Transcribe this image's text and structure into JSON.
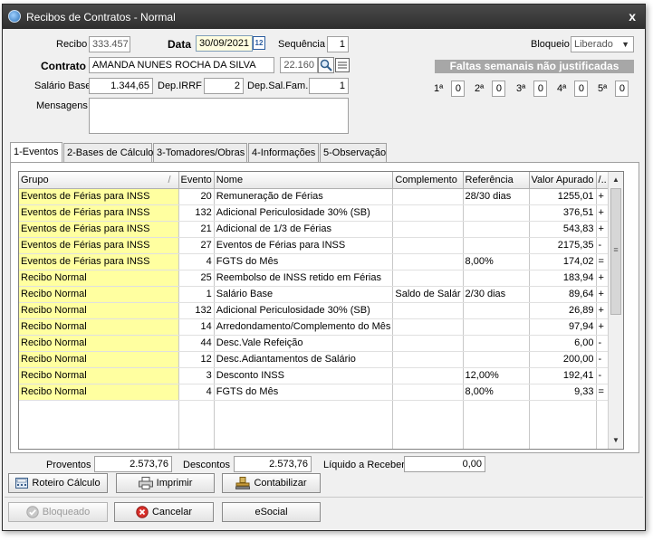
{
  "window": {
    "title": "Recibos de Contratos - Normal",
    "close": "x"
  },
  "form": {
    "recibo_label": "Recibo",
    "recibo_value": "333.457",
    "data_label": "Data",
    "data_value": "30/09/2021",
    "calendar_day": "12",
    "sequencia_label": "Sequência",
    "sequencia_value": "1",
    "bloqueio_label": "Bloqueio",
    "bloqueio_value": "Liberado",
    "contrato_label": "Contrato",
    "contrato_nome": "AMANDA NUNES ROCHA DA SILVA",
    "contrato_num": "22.160",
    "salario_label": "Salário Base",
    "salario_value": "1.344,65",
    "dep_irrf_label": "Dep.IRRF",
    "dep_irrf_value": "2",
    "dep_salfam_label": "Dep.Sal.Fam.",
    "dep_salfam_value": "1",
    "mensagens_label": "Mensagens",
    "mensagens_value": ""
  },
  "faltas": {
    "title": "Faltas semanais não justificadas",
    "weeks": [
      {
        "label": "1ª",
        "value": "0"
      },
      {
        "label": "2ª",
        "value": "0"
      },
      {
        "label": "3ª",
        "value": "0"
      },
      {
        "label": "4ª",
        "value": "0"
      },
      {
        "label": "5ª",
        "value": "0"
      }
    ]
  },
  "tabs": [
    {
      "label": "1-Eventos",
      "active": true
    },
    {
      "label": "2-Bases de Cálculo",
      "active": false
    },
    {
      "label": "3-Tomadores/Obras",
      "active": false
    },
    {
      "label": "4-Informações",
      "active": false
    },
    {
      "label": "5-Observação",
      "active": false
    }
  ],
  "grid": {
    "columns": [
      "Grupo",
      "Evento",
      "Nome",
      "Complemento",
      "Referência",
      "Valor Apurado",
      "/.."
    ],
    "sort_indicator": "/",
    "rows": [
      {
        "grupo": "Eventos de Férias para INSS",
        "evento": "20",
        "nome": "Remuneração de Férias",
        "complemento": "",
        "referencia": "28/30 dias",
        "valor": "1255,01",
        "sinal": "+"
      },
      {
        "grupo": "Eventos de Férias para INSS",
        "evento": "132",
        "nome": "Adicional Periculosidade 30% (SB)",
        "complemento": "",
        "referencia": "",
        "valor": "376,51",
        "sinal": "+"
      },
      {
        "grupo": "Eventos de Férias para INSS",
        "evento": "21",
        "nome": "Adicional de 1/3 de Férias",
        "complemento": "",
        "referencia": "",
        "valor": "543,83",
        "sinal": "+"
      },
      {
        "grupo": "Eventos de Férias para INSS",
        "evento": "27",
        "nome": "Eventos de Férias para INSS",
        "complemento": "",
        "referencia": "",
        "valor": "2175,35",
        "sinal": "-"
      },
      {
        "grupo": "Eventos de Férias para INSS",
        "evento": "4",
        "nome": "FGTS do Mês",
        "complemento": "",
        "referencia": "8,00%",
        "valor": "174,02",
        "sinal": "="
      },
      {
        "grupo": "Recibo Normal",
        "evento": "25",
        "nome": "Reembolso de INSS retido em Férias",
        "complemento": "",
        "referencia": "",
        "valor": "183,94",
        "sinal": "+"
      },
      {
        "grupo": "Recibo Normal",
        "evento": "1",
        "nome": "Salário Base",
        "complemento": "Saldo de Salár",
        "referencia": "2/30 dias",
        "valor": "89,64",
        "sinal": "+"
      },
      {
        "grupo": "Recibo Normal",
        "evento": "132",
        "nome": "Adicional Periculosidade 30% (SB)",
        "complemento": "",
        "referencia": "",
        "valor": "26,89",
        "sinal": "+"
      },
      {
        "grupo": "Recibo Normal",
        "evento": "14",
        "nome": "Arredondamento/Complemento do Mês",
        "complemento": "",
        "referencia": "",
        "valor": "97,94",
        "sinal": "+"
      },
      {
        "grupo": "Recibo Normal",
        "evento": "44",
        "nome": "Desc.Vale Refeição",
        "complemento": "",
        "referencia": "",
        "valor": "6,00",
        "sinal": "-"
      },
      {
        "grupo": "Recibo Normal",
        "evento": "12",
        "nome": "Desc.Adiantamentos de Salário",
        "complemento": "",
        "referencia": "",
        "valor": "200,00",
        "sinal": "-"
      },
      {
        "grupo": "Recibo Normal",
        "evento": "3",
        "nome": "Desconto INSS",
        "complemento": "",
        "referencia": "12,00%",
        "valor": "192,41",
        "sinal": "-"
      },
      {
        "grupo": "Recibo Normal",
        "evento": "4",
        "nome": "FGTS do Mês",
        "complemento": "",
        "referencia": "8,00%",
        "valor": "9,33",
        "sinal": "="
      }
    ]
  },
  "totals": {
    "proventos_label": "Proventos",
    "proventos_value": "2.573,76",
    "descontos_label": "Descontos",
    "descontos_value": "2.573,76",
    "liquido_label": "Líquido a Receber",
    "liquido_value": "0,00"
  },
  "buttons": {
    "roteiro": "Roteiro Cálculo",
    "imprimir": "Imprimir",
    "contabilizar": "Contabilizar",
    "bloqueado": "Bloqueado",
    "cancelar": "Cancelar",
    "esocial": "eSocial"
  },
  "colors": {
    "grupo_bg": "#ffffa0",
    "titlebar": "#3a3a3a",
    "banner": "#a7a7a7"
  }
}
